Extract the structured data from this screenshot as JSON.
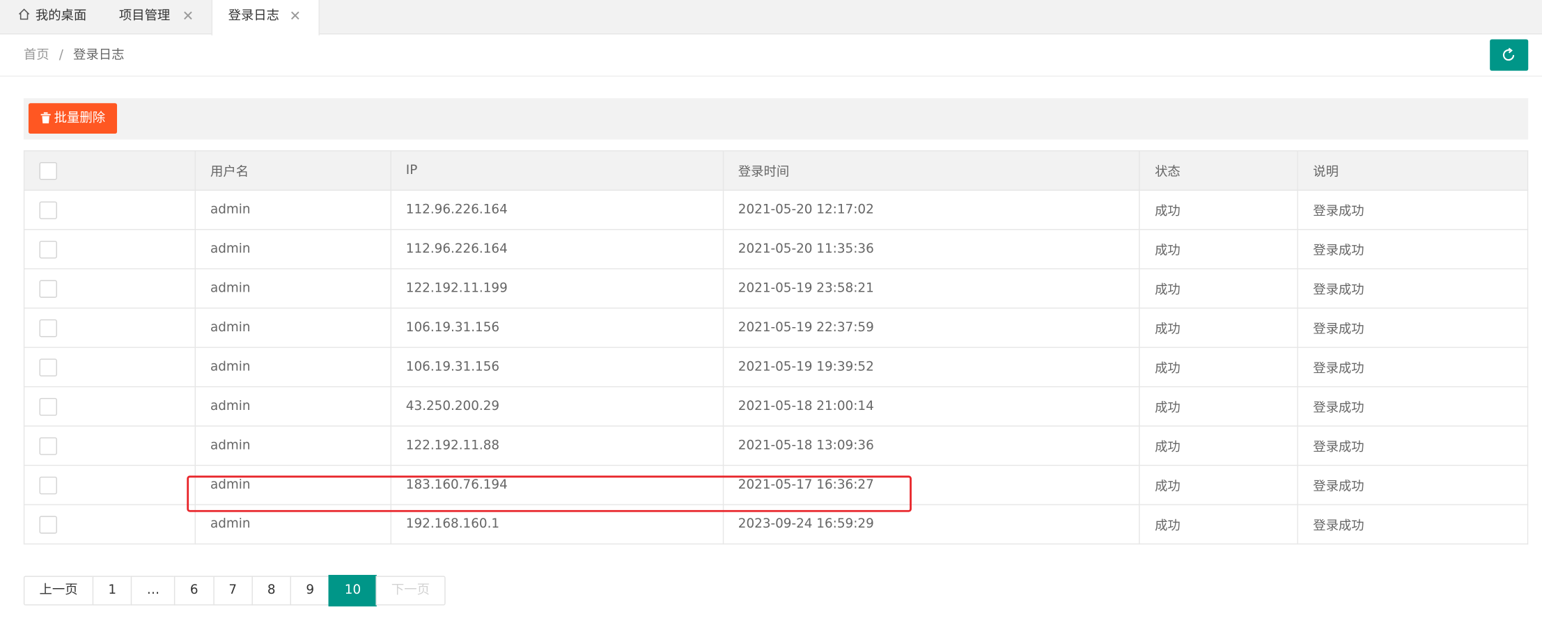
{
  "tabs": {
    "home": "我的桌面",
    "project": "项目管理",
    "active": "登录日志",
    "close_glyph": "✕"
  },
  "breadcrumb": {
    "home": "首页",
    "separator": "/",
    "current": "登录日志"
  },
  "toolbar": {
    "batch_delete": "批量删除"
  },
  "colors": {
    "accent": "#009688",
    "danger": "#FF5722",
    "highlight": "#E8262B"
  },
  "table": {
    "headers": [
      "用户名",
      "IP",
      "登录时间",
      "状态",
      "说明"
    ],
    "rows": [
      [
        "admin",
        "112.96.226.164",
        "2021-05-20 12:17:02",
        "成功",
        "登录成功"
      ],
      [
        "admin",
        "112.96.226.164",
        "2021-05-20 11:35:36",
        "成功",
        "登录成功"
      ],
      [
        "admin",
        "122.192.11.199",
        "2021-05-19 23:58:21",
        "成功",
        "登录成功"
      ],
      [
        "admin",
        "106.19.31.156",
        "2021-05-19 22:37:59",
        "成功",
        "登录成功"
      ],
      [
        "admin",
        "106.19.31.156",
        "2021-05-19 19:39:52",
        "成功",
        "登录成功"
      ],
      [
        "admin",
        "43.250.200.29",
        "2021-05-18 21:00:14",
        "成功",
        "登录成功"
      ],
      [
        "admin",
        "122.192.11.88",
        "2021-05-18 13:09:36",
        "成功",
        "登录成功"
      ],
      [
        "admin",
        "183.160.76.194",
        "2021-05-17 16:36:27",
        "成功",
        "登录成功"
      ],
      [
        "admin",
        "192.168.160.1",
        "2023-09-24 16:59:29",
        "成功",
        "登录成功"
      ]
    ]
  },
  "pagination": {
    "prev": "上一页",
    "pages": [
      "1",
      "…",
      "6",
      "7",
      "8",
      "9",
      "10"
    ],
    "current": "10",
    "next": "下一页"
  }
}
